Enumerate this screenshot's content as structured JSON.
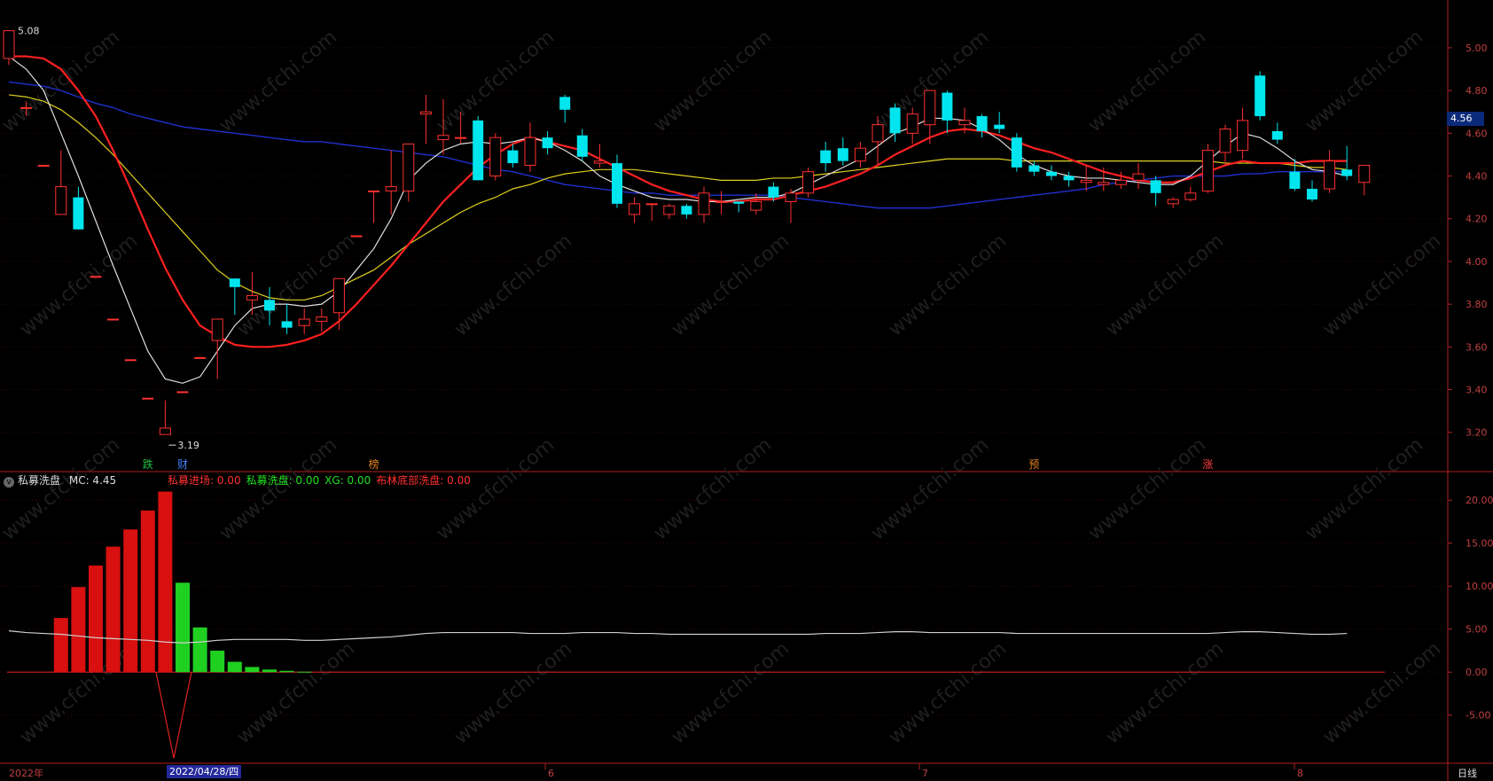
{
  "price_axis": {
    "ticks": [
      "5.00",
      "4.80",
      "4.60",
      "4.40",
      "4.20",
      "4.00",
      "3.80",
      "3.60",
      "3.40",
      "3.20"
    ],
    "current": "4.56"
  },
  "annotations": {
    "high": "5.08",
    "low": "3.19"
  },
  "signals": [
    {
      "text": "跌",
      "color": "#20c040"
    },
    {
      "text": "财",
      "color": "#4080ff"
    },
    {
      "text": "榜",
      "color": "#e08020"
    },
    {
      "text": "预",
      "color": "#e08020"
    },
    {
      "text": "涨",
      "color": "#ff4040"
    }
  ],
  "indicator": {
    "name": "私募洗盘",
    "mc_label": "MC: 4.45",
    "legend": [
      {
        "text": "私募进场: 0.00",
        "color": "#ff3030"
      },
      {
        "text": "私募洗盘: 0.00",
        "color": "#20e020"
      },
      {
        "text": "XG: 0.00",
        "color": "#20e020"
      },
      {
        "text": "布林底部洗盘: 0.00",
        "color": "#ff3030"
      }
    ],
    "ticks": [
      "20.00",
      "15.00",
      "10.00",
      "5.00",
      "0.00",
      "-5.00"
    ]
  },
  "x_axis": {
    "labels": [
      "2022年",
      "6",
      "7",
      "8"
    ],
    "cursor_date": "2022/04/28/四",
    "period": "日线"
  },
  "watermark": "www.cfchi.com",
  "colors": {
    "up": "#ff3030",
    "down": "#00e5ee",
    "ma5": "#e0e0e0",
    "ma10": "#ff2020",
    "ma20": "#e0d020",
    "ma60": "#2030d0"
  },
  "chart_data": {
    "type": "candlestick",
    "ylim": [
      3.12,
      5.12
    ],
    "candles": [
      {
        "o": 4.95,
        "c": 5.08,
        "h": 5.08,
        "l": 4.92
      },
      {
        "o": 4.72,
        "c": 4.72,
        "h": 4.75,
        "l": 4.68
      },
      {
        "o": 4.45,
        "c": 4.45,
        "h": 4.45,
        "l": 4.45
      },
      {
        "o": 4.22,
        "c": 4.35,
        "h": 4.52,
        "l": 4.22
      },
      {
        "o": 4.3,
        "c": 4.15,
        "h": 4.35,
        "l": 4.15
      },
      {
        "o": 3.93,
        "c": 3.93,
        "h": 3.93,
        "l": 3.93
      },
      {
        "o": 3.73,
        "c": 3.73,
        "h": 3.73,
        "l": 3.73
      },
      {
        "o": 3.54,
        "c": 3.54,
        "h": 3.54,
        "l": 3.54
      },
      {
        "o": 3.36,
        "c": 3.36,
        "h": 3.36,
        "l": 3.36
      },
      {
        "o": 3.19,
        "c": 3.22,
        "h": 3.35,
        "l": 3.19
      },
      {
        "o": 3.39,
        "c": 3.39,
        "h": 3.39,
        "l": 3.39
      },
      {
        "o": 3.55,
        "c": 3.55,
        "h": 3.55,
        "l": 3.55
      },
      {
        "o": 3.63,
        "c": 3.73,
        "h": 3.73,
        "l": 3.45
      },
      {
        "o": 3.92,
        "c": 3.88,
        "h": 3.92,
        "l": 3.75
      },
      {
        "o": 3.82,
        "c": 3.84,
        "h": 3.95,
        "l": 3.75
      },
      {
        "o": 3.82,
        "c": 3.77,
        "h": 3.88,
        "l": 3.7
      },
      {
        "o": 3.72,
        "c": 3.69,
        "h": 3.8,
        "l": 3.66
      },
      {
        "o": 3.7,
        "c": 3.73,
        "h": 3.78,
        "l": 3.66
      },
      {
        "o": 3.72,
        "c": 3.74,
        "h": 3.78,
        "l": 3.67
      },
      {
        "o": 3.76,
        "c": 3.92,
        "h": 3.92,
        "l": 3.68
      },
      {
        "o": 4.12,
        "c": 4.12,
        "h": 4.12,
        "l": 4.12
      },
      {
        "o": 4.33,
        "c": 4.33,
        "h": 4.33,
        "l": 4.18
      },
      {
        "o": 4.33,
        "c": 4.35,
        "h": 4.52,
        "l": 4.22
      },
      {
        "o": 4.33,
        "c": 4.55,
        "h": 4.55,
        "l": 4.28
      },
      {
        "o": 4.69,
        "c": 4.7,
        "h": 4.78,
        "l": 4.55
      },
      {
        "o": 4.57,
        "c": 4.59,
        "h": 4.76,
        "l": 4.5
      },
      {
        "o": 4.58,
        "c": 4.58,
        "h": 4.7,
        "l": 4.55
      },
      {
        "o": 4.66,
        "c": 4.38,
        "h": 4.68,
        "l": 4.38
      },
      {
        "o": 4.4,
        "c": 4.58,
        "h": 4.6,
        "l": 4.38
      },
      {
        "o": 4.52,
        "c": 4.46,
        "h": 4.55,
        "l": 4.44
      },
      {
        "o": 4.45,
        "c": 4.58,
        "h": 4.65,
        "l": 4.42
      },
      {
        "o": 4.58,
        "c": 4.53,
        "h": 4.61,
        "l": 4.5
      },
      {
        "o": 4.77,
        "c": 4.71,
        "h": 4.78,
        "l": 4.65
      },
      {
        "o": 4.59,
        "c": 4.49,
        "h": 4.62,
        "l": 4.47
      },
      {
        "o": 4.46,
        "c": 4.47,
        "h": 4.55,
        "l": 4.44
      },
      {
        "o": 4.46,
        "c": 4.27,
        "h": 4.5,
        "l": 4.25
      },
      {
        "o": 4.22,
        "c": 4.27,
        "h": 4.3,
        "l": 4.18
      },
      {
        "o": 4.27,
        "c": 4.27,
        "h": 4.27,
        "l": 4.19
      },
      {
        "o": 4.22,
        "c": 4.26,
        "h": 4.27,
        "l": 4.2
      },
      {
        "o": 4.26,
        "c": 4.22,
        "h": 4.27,
        "l": 4.2
      },
      {
        "o": 4.22,
        "c": 4.32,
        "h": 4.35,
        "l": 4.18
      },
      {
        "o": 4.28,
        "c": 4.28,
        "h": 4.33,
        "l": 4.22
      },
      {
        "o": 4.28,
        "c": 4.27,
        "h": 4.28,
        "l": 4.23
      },
      {
        "o": 4.24,
        "c": 4.28,
        "h": 4.32,
        "l": 4.22
      },
      {
        "o": 4.35,
        "c": 4.3,
        "h": 4.37,
        "l": 4.28
      },
      {
        "o": 4.28,
        "c": 4.32,
        "h": 4.34,
        "l": 4.18
      },
      {
        "o": 4.32,
        "c": 4.42,
        "h": 4.44,
        "l": 4.3
      },
      {
        "o": 4.52,
        "c": 4.46,
        "h": 4.56,
        "l": 4.42
      },
      {
        "o": 4.53,
        "c": 4.47,
        "h": 4.58,
        "l": 4.45
      },
      {
        "o": 4.47,
        "c": 4.53,
        "h": 4.56,
        "l": 4.44
      },
      {
        "o": 4.56,
        "c": 4.64,
        "h": 4.68,
        "l": 4.45
      },
      {
        "o": 4.72,
        "c": 4.6,
        "h": 4.74,
        "l": 4.56
      },
      {
        "o": 4.6,
        "c": 4.69,
        "h": 4.72,
        "l": 4.55
      },
      {
        "o": 4.64,
        "c": 4.8,
        "h": 4.8,
        "l": 4.55
      },
      {
        "o": 4.79,
        "c": 4.66,
        "h": 4.8,
        "l": 4.6
      },
      {
        "o": 4.64,
        "c": 4.66,
        "h": 4.72,
        "l": 4.6
      },
      {
        "o": 4.68,
        "c": 4.61,
        "h": 4.69,
        "l": 4.58
      },
      {
        "o": 4.64,
        "c": 4.62,
        "h": 4.7,
        "l": 4.6
      },
      {
        "o": 4.58,
        "c": 4.44,
        "h": 4.6,
        "l": 4.42
      },
      {
        "o": 4.45,
        "c": 4.42,
        "h": 4.47,
        "l": 4.4
      },
      {
        "o": 4.42,
        "c": 4.4,
        "h": 4.45,
        "l": 4.38
      },
      {
        "o": 4.4,
        "c": 4.38,
        "h": 4.42,
        "l": 4.35
      },
      {
        "o": 4.37,
        "c": 4.38,
        "h": 4.45,
        "l": 4.33
      },
      {
        "o": 4.36,
        "c": 4.37,
        "h": 4.44,
        "l": 4.33
      },
      {
        "o": 4.36,
        "c": 4.38,
        "h": 4.42,
        "l": 4.34
      },
      {
        "o": 4.38,
        "c": 4.41,
        "h": 4.46,
        "l": 4.34
      },
      {
        "o": 4.38,
        "c": 4.32,
        "h": 4.4,
        "l": 4.26
      },
      {
        "o": 4.27,
        "c": 4.29,
        "h": 4.3,
        "l": 4.25
      },
      {
        "o": 4.29,
        "c": 4.32,
        "h": 4.35,
        "l": 4.28
      },
      {
        "o": 4.33,
        "c": 4.52,
        "h": 4.55,
        "l": 4.32
      },
      {
        "o": 4.51,
        "c": 4.62,
        "h": 4.64,
        "l": 4.45
      },
      {
        "o": 4.52,
        "c": 4.66,
        "h": 4.72,
        "l": 4.48
      },
      {
        "o": 4.87,
        "c": 4.68,
        "h": 4.89,
        "l": 4.66
      },
      {
        "o": 4.61,
        "c": 4.57,
        "h": 4.65,
        "l": 4.55
      },
      {
        "o": 4.42,
        "c": 4.34,
        "h": 4.48,
        "l": 4.33
      },
      {
        "o": 4.34,
        "c": 4.29,
        "h": 4.38,
        "l": 4.28
      },
      {
        "o": 4.34,
        "c": 4.47,
        "h": 4.52,
        "l": 4.32
      },
      {
        "o": 4.43,
        "c": 4.4,
        "h": 4.54,
        "l": 4.38
      },
      {
        "o": 4.37,
        "c": 4.45,
        "h": 4.45,
        "l": 4.31
      }
    ],
    "ma5": [
      4.96,
      4.9,
      4.8,
      4.6,
      4.4,
      4.19,
      3.98,
      3.78,
      3.58,
      3.45,
      3.43,
      3.46,
      3.58,
      3.7,
      3.78,
      3.8,
      3.8,
      3.79,
      3.8,
      3.86,
      3.96,
      4.06,
      4.2,
      4.38,
      4.46,
      4.52,
      4.55,
      4.56,
      4.55,
      4.56,
      4.58,
      4.56,
      4.52,
      4.47,
      4.4,
      4.36,
      4.33,
      4.3,
      4.29,
      4.29,
      4.28,
      4.28,
      4.29,
      4.3,
      4.3,
      4.32,
      4.36,
      4.4,
      4.44,
      4.48,
      4.54,
      4.6,
      4.63,
      4.67,
      4.67,
      4.66,
      4.62,
      4.57,
      4.5,
      4.45,
      4.42,
      4.4,
      4.39,
      4.39,
      4.38,
      4.37,
      4.36,
      4.36,
      4.4,
      4.47,
      4.54,
      4.6,
      4.58,
      4.53,
      4.47,
      4.43,
      4.42,
      4.4
    ],
    "ma10": [
      4.96,
      4.96,
      4.95,
      4.9,
      4.8,
      4.68,
      4.52,
      4.34,
      4.15,
      3.97,
      3.82,
      3.7,
      3.65,
      3.61,
      3.6,
      3.6,
      3.61,
      3.63,
      3.66,
      3.72,
      3.8,
      3.89,
      3.98,
      4.08,
      4.18,
      4.28,
      4.36,
      4.44,
      4.5,
      4.55,
      4.58,
      4.56,
      4.54,
      4.52,
      4.48,
      4.44,
      4.4,
      4.36,
      4.33,
      4.31,
      4.29,
      4.28,
      4.28,
      4.29,
      4.29,
      4.31,
      4.33,
      4.35,
      4.38,
      4.41,
      4.45,
      4.5,
      4.54,
      4.58,
      4.61,
      4.62,
      4.61,
      4.59,
      4.56,
      4.53,
      4.51,
      4.48,
      4.45,
      4.42,
      4.4,
      4.38,
      4.37,
      4.37,
      4.39,
      4.42,
      4.45,
      4.47,
      4.46,
      4.46,
      4.46,
      4.47,
      4.47,
      4.47
    ],
    "ma20": [
      4.78,
      4.77,
      4.75,
      4.71,
      4.65,
      4.58,
      4.5,
      4.41,
      4.32,
      4.23,
      4.14,
      4.05,
      3.96,
      3.9,
      3.86,
      3.83,
      3.82,
      3.82,
      3.84,
      3.88,
      3.92,
      3.96,
      4.02,
      4.08,
      4.13,
      4.18,
      4.23,
      4.27,
      4.3,
      4.34,
      4.36,
      4.39,
      4.41,
      4.42,
      4.43,
      4.43,
      4.43,
      4.42,
      4.41,
      4.4,
      4.39,
      4.38,
      4.38,
      4.38,
      4.39,
      4.39,
      4.4,
      4.41,
      4.42,
      4.43,
      4.44,
      4.45,
      4.46,
      4.47,
      4.48,
      4.48,
      4.48,
      4.48,
      4.47,
      4.47,
      4.47,
      4.47,
      4.47,
      4.47,
      4.47,
      4.47,
      4.47,
      4.47,
      4.47,
      4.47,
      4.46,
      4.46,
      4.46,
      4.46,
      4.45,
      4.44,
      4.44,
      4.43
    ],
    "ma60": [
      4.84,
      4.83,
      4.82,
      4.8,
      4.77,
      4.74,
      4.72,
      4.69,
      4.67,
      4.65,
      4.63,
      4.62,
      4.61,
      4.6,
      4.59,
      4.58,
      4.57,
      4.56,
      4.56,
      4.55,
      4.54,
      4.53,
      4.52,
      4.51,
      4.5,
      4.49,
      4.47,
      4.45,
      4.43,
      4.42,
      4.4,
      4.38,
      4.36,
      4.35,
      4.34,
      4.33,
      4.32,
      4.32,
      4.31,
      4.31,
      4.31,
      4.31,
      4.31,
      4.31,
      4.31,
      4.3,
      4.29,
      4.28,
      4.27,
      4.26,
      4.25,
      4.25,
      4.25,
      4.25,
      4.26,
      4.27,
      4.28,
      4.29,
      4.3,
      4.31,
      4.32,
      4.33,
      4.34,
      4.36,
      4.37,
      4.38,
      4.39,
      4.4,
      4.4,
      4.4,
      4.4,
      4.41,
      4.41,
      4.42,
      4.42,
      4.42,
      4.42,
      4.42
    ],
    "indicator_ylim": [
      -10.5,
      22.5
    ],
    "red_bars": [
      0,
      0,
      0,
      6.3,
      9.9,
      12.4,
      14.6,
      16.6,
      18.8,
      21.0
    ],
    "green_bars": [
      0,
      0,
      0,
      0,
      0,
      0,
      0,
      0,
      0,
      0,
      10.4,
      5.2,
      2.5,
      1.2,
      0.6,
      0.3,
      0.15,
      0.05
    ],
    "mc_line": [
      4.8,
      4.6,
      4.5,
      4.4,
      4.2,
      4.0,
      3.9,
      3.8,
      3.7,
      3.5,
      3.4,
      3.5,
      3.7,
      3.8,
      3.8,
      3.8,
      3.8,
      3.7,
      3.7,
      3.8,
      3.9,
      4.0,
      4.1,
      4.3,
      4.5,
      4.6,
      4.6,
      4.6,
      4.6,
      4.6,
      4.5,
      4.5,
      4.5,
      4.6,
      4.6,
      4.6,
      4.5,
      4.5,
      4.4,
      4.4,
      4.4,
      4.4,
      4.4,
      4.4,
      4.4,
      4.4,
      4.4,
      4.5,
      4.5,
      4.5,
      4.6,
      4.7,
      4.7,
      4.6,
      4.6,
      4.6,
      4.6,
      4.6,
      4.5,
      4.5,
      4.5,
      4.5,
      4.5,
      4.5,
      4.5,
      4.5,
      4.5,
      4.5,
      4.5,
      4.5,
      4.6,
      4.7,
      4.7,
      4.6,
      4.5,
      4.4,
      4.4,
      4.5
    ],
    "spike_min": -10.0
  }
}
